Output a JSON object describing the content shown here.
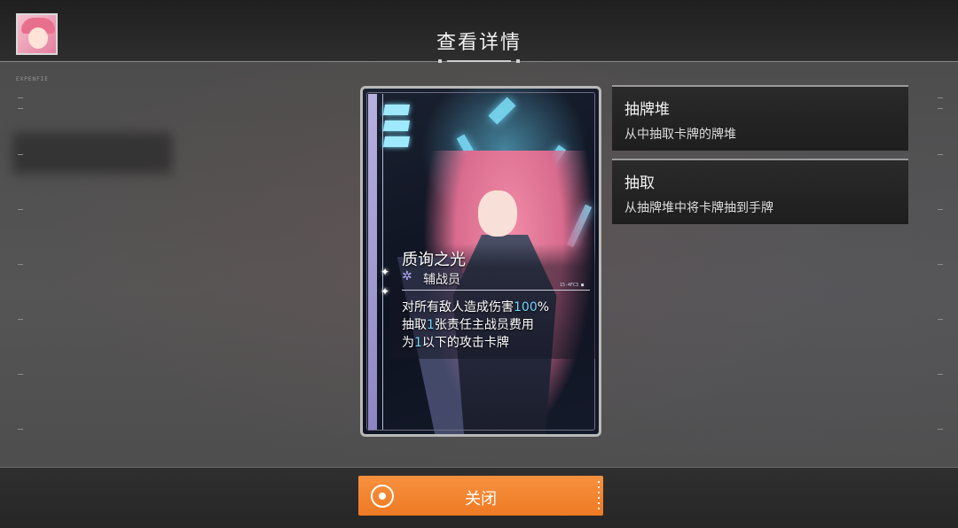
{
  "header": {
    "title": "查看详情"
  },
  "hud": {
    "label": "EXPENFIE"
  },
  "card": {
    "name": "质询之光",
    "role": "辅战员",
    "code": "15-4FC3 ■",
    "description": [
      [
        {
          "t": "对所有敌人造成伤害"
        },
        {
          "t": "100",
          "hl": true
        },
        {
          "t": "%"
        }
      ],
      [
        {
          "t": "抽取"
        },
        {
          "t": "1",
          "hl": true
        },
        {
          "t": "张责任主战员费用"
        }
      ],
      [
        {
          "t": "为"
        },
        {
          "t": "1",
          "hl": true
        },
        {
          "t": "以下的攻击卡牌"
        }
      ]
    ]
  },
  "keywords": [
    {
      "title": "抽牌堆",
      "desc": "从中抽取卡牌的牌堆"
    },
    {
      "title": "抽取",
      "desc": "从抽牌堆中将卡牌抽到手牌"
    }
  ],
  "footer": {
    "close_label": "关闭"
  },
  "icons": {
    "avatar": "avatar-portrait",
    "role": "support-role-icon",
    "close": "radio-ring-icon"
  },
  "colors": {
    "accent": "#f08a33",
    "highlight_number": "#6fd6ff",
    "role_icon": "#b4a6ff"
  }
}
